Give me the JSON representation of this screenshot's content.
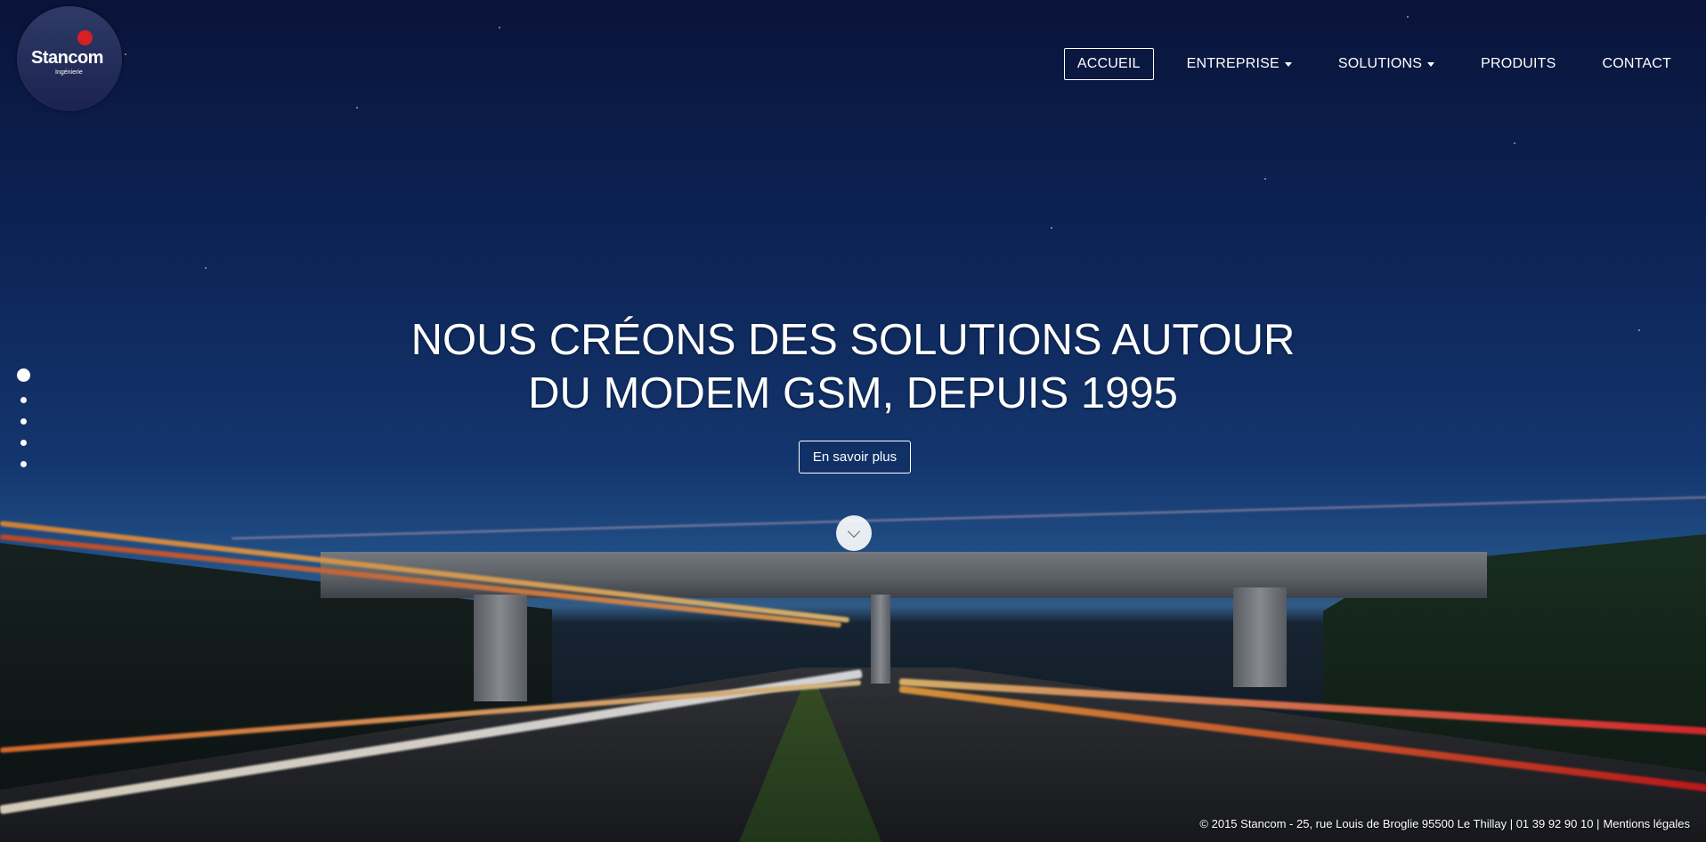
{
  "brand": {
    "name": "Stancom",
    "tagline": "Ingénierie",
    "accent": "#d71f26"
  },
  "nav": {
    "items": [
      {
        "label": "ACCUEIL",
        "active": true,
        "dropdown": false
      },
      {
        "label": "ENTREPRISE",
        "active": false,
        "dropdown": true
      },
      {
        "label": "SOLUTIONS",
        "active": false,
        "dropdown": true
      },
      {
        "label": "PRODUITS",
        "active": false,
        "dropdown": false
      },
      {
        "label": "CONTACT",
        "active": false,
        "dropdown": false
      }
    ]
  },
  "hero": {
    "headline_line1": "NOUS CRÉONS DES SOLUTIONS AUTOUR",
    "headline_line2": "DU MODEM GSM, DEPUIS 1995",
    "cta_label": "En savoir plus",
    "scroll_icon": "chevron-down-icon"
  },
  "slider": {
    "count": 5,
    "active_index": 0
  },
  "footer": {
    "text": "© 2015 Stancom - 25, rue Louis de Broglie 95500 Le Thillay | 01 39 92 90 10 |",
    "legal_link": "Mentions légales"
  }
}
